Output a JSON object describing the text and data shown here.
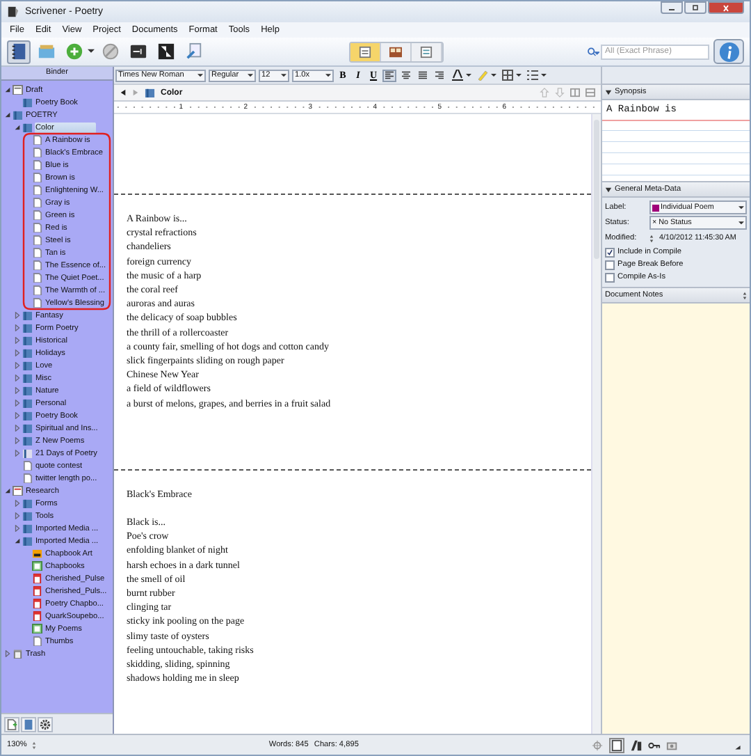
{
  "window": {
    "title": "Scrivener - Poetry"
  },
  "menu": [
    "File",
    "Edit",
    "View",
    "Project",
    "Documents",
    "Format",
    "Tools",
    "Help"
  ],
  "toolbar": {
    "view_modes": [
      {
        "selected": true
      },
      {
        "selected": false
      },
      {
        "selected": false
      }
    ],
    "search": {
      "placeholder": "All (Exact Phrase)"
    }
  },
  "binder": {
    "title": "Binder",
    "items": [
      {
        "label": "Draft",
        "kind": "draft",
        "expanded": true,
        "selected": false,
        "children": [
          {
            "label": "Poetry Book",
            "kind": "folder",
            "selected": false
          }
        ]
      },
      {
        "label": "POETRY",
        "kind": "folder",
        "expanded": true,
        "selected": false,
        "children": [
          {
            "label": "Color",
            "kind": "folder",
            "expanded": true,
            "selected": true,
            "children": [
              {
                "label": "A Rainbow is",
                "kind": "doc",
                "selected": false
              },
              {
                "label": "Black's Embrace",
                "kind": "doc",
                "selected": false
              },
              {
                "label": "Blue is",
                "kind": "doc",
                "selected": false
              },
              {
                "label": "Brown is",
                "kind": "doc",
                "selected": false
              },
              {
                "label": "Enlightening W...",
                "kind": "doc",
                "selected": false
              },
              {
                "label": "Gray is",
                "kind": "doc",
                "selected": false
              },
              {
                "label": "Green is",
                "kind": "doc",
                "selected": false
              },
              {
                "label": "Red is",
                "kind": "doc",
                "selected": false
              },
              {
                "label": "Steel is",
                "kind": "doc",
                "selected": false
              },
              {
                "label": "Tan is",
                "kind": "doc",
                "selected": false
              },
              {
                "label": "The Essence of...",
                "kind": "doc",
                "selected": false
              },
              {
                "label": "The Quiet Poet...",
                "kind": "doc",
                "selected": false
              },
              {
                "label": "The Warmth of ...",
                "kind": "doc",
                "selected": false
              },
              {
                "label": "Yellow's Blessing",
                "kind": "doc",
                "selected": false
              }
            ]
          },
          {
            "label": "Fantasy",
            "kind": "folder",
            "expanded": false,
            "selected": false
          },
          {
            "label": "Form Poetry",
            "kind": "folder",
            "expanded": false,
            "selected": false
          },
          {
            "label": "Historical",
            "kind": "folder",
            "expanded": false,
            "selected": false
          },
          {
            "label": "Holidays",
            "kind": "folder",
            "expanded": false,
            "selected": false
          },
          {
            "label": "Love",
            "kind": "folder",
            "expanded": false,
            "selected": false
          },
          {
            "label": "Misc",
            "kind": "folder",
            "expanded": false,
            "selected": false
          },
          {
            "label": "Nature",
            "kind": "folder",
            "expanded": false,
            "selected": false
          },
          {
            "label": "Personal",
            "kind": "folder",
            "expanded": false,
            "selected": false
          },
          {
            "label": "Poetry Book",
            "kind": "folder",
            "expanded": false,
            "selected": false
          },
          {
            "label": "Spiritual and Ins...",
            "kind": "folder",
            "expanded": false,
            "selected": false
          },
          {
            "label": "Z New Poems",
            "kind": "folder",
            "expanded": false,
            "selected": false
          },
          {
            "label": "21 Days of Poetry",
            "kind": "stack",
            "expanded": false,
            "selected": false
          },
          {
            "label": "quote contest",
            "kind": "doc",
            "selected": false
          },
          {
            "label": "twitter length po...",
            "kind": "doc",
            "selected": false
          }
        ]
      },
      {
        "label": "Research",
        "kind": "research",
        "expanded": true,
        "selected": false,
        "children": [
          {
            "label": "Forms",
            "kind": "folder",
            "expanded": false,
            "selected": false
          },
          {
            "label": "Tools",
            "kind": "folder",
            "expanded": false,
            "selected": false
          },
          {
            "label": "Imported Media ...",
            "kind": "folder",
            "expanded": false,
            "selected": false
          },
          {
            "label": "Imported Media ...",
            "kind": "folder",
            "expanded": true,
            "selected": false,
            "children": [
              {
                "label": "Chapbook Art",
                "kind": "image",
                "selected": false
              },
              {
                "label": "Chapbooks",
                "kind": "sheet",
                "selected": false
              },
              {
                "label": "Cherished_Pulse",
                "kind": "pdf",
                "selected": false
              },
              {
                "label": "Cherished_Puls...",
                "kind": "pdf",
                "selected": false
              },
              {
                "label": "Poetry Chapbo...",
                "kind": "pdf",
                "selected": false
              },
              {
                "label": "QuarkSoupebo...",
                "kind": "pdf",
                "selected": false
              },
              {
                "label": "My Poems",
                "kind": "sheet",
                "selected": false
              },
              {
                "label": "Thumbs",
                "kind": "file",
                "selected": false
              }
            ]
          }
        ]
      },
      {
        "label": "Trash",
        "kind": "trash",
        "expanded": false,
        "selected": false
      }
    ]
  },
  "annotation": {
    "kind": "ellipse"
  },
  "format_bar": {
    "font": "Times New Roman",
    "style": "Regular",
    "size": "12",
    "spacing": "1.0x",
    "bold": "B",
    "italic": "I",
    "underline": "U",
    "alignments": [
      {
        "selected": true
      },
      {
        "selected": false
      },
      {
        "selected": false
      },
      {
        "selected": false
      }
    ]
  },
  "editor": {
    "title": "Color",
    "ruler": [
      "1",
      "2",
      "3",
      "4",
      "5",
      "6"
    ],
    "documents": [
      {
        "stanzas": [
          [
            "A Rainbow is...",
            "crystal refractions",
            "chandeliers",
            "foreign currency",
            "the music of a harp",
            "the coral reef",
            "auroras and auras",
            "the delicacy of soap bubbles",
            "the thrill of a rollercoaster",
            "a county fair, smelling of hot dogs and cotton candy",
            "slick fingerpaints sliding on rough paper",
            "Chinese New Year",
            "a field of wildflowers",
            "a burst of melons, grapes, and berries in a fruit salad"
          ]
        ]
      },
      {
        "stanzas": [
          [
            "Black's Embrace"
          ],
          [
            "Black is...",
            "Poe's crow",
            "enfolding blanket of night",
            "harsh echoes in a dark tunnel",
            "the smell of oil",
            "burnt rubber",
            "clinging tar",
            "sticky ink pooling on the page",
            "slimy taste of oysters",
            "feeling untouchable, taking risks",
            "skidding, sliding, spinning",
            "shadows holding me in sleep"
          ]
        ]
      }
    ]
  },
  "inspector": {
    "synopsis_title": "Synopsis",
    "synopsis": "A Rainbow is",
    "metadata_title": "General Meta-Data",
    "label": {
      "caption": "Label:",
      "value": "Individual Poem",
      "color": "#a0007a"
    },
    "status": {
      "caption": "Status:",
      "value": "No Status",
      "marker": "×"
    },
    "modified": {
      "caption": "Modified:",
      "value": "4/10/2012 11:45:30 AM"
    },
    "options": [
      {
        "label": "Include in Compile",
        "checked": true
      },
      {
        "label": "Page Break Before",
        "checked": false
      },
      {
        "label": "Compile As-Is",
        "checked": false
      }
    ],
    "notes_title": "Document Notes"
  },
  "status_bar": {
    "zoom": "130%",
    "words": "Words: 845",
    "chars": "Chars: 4,895"
  }
}
